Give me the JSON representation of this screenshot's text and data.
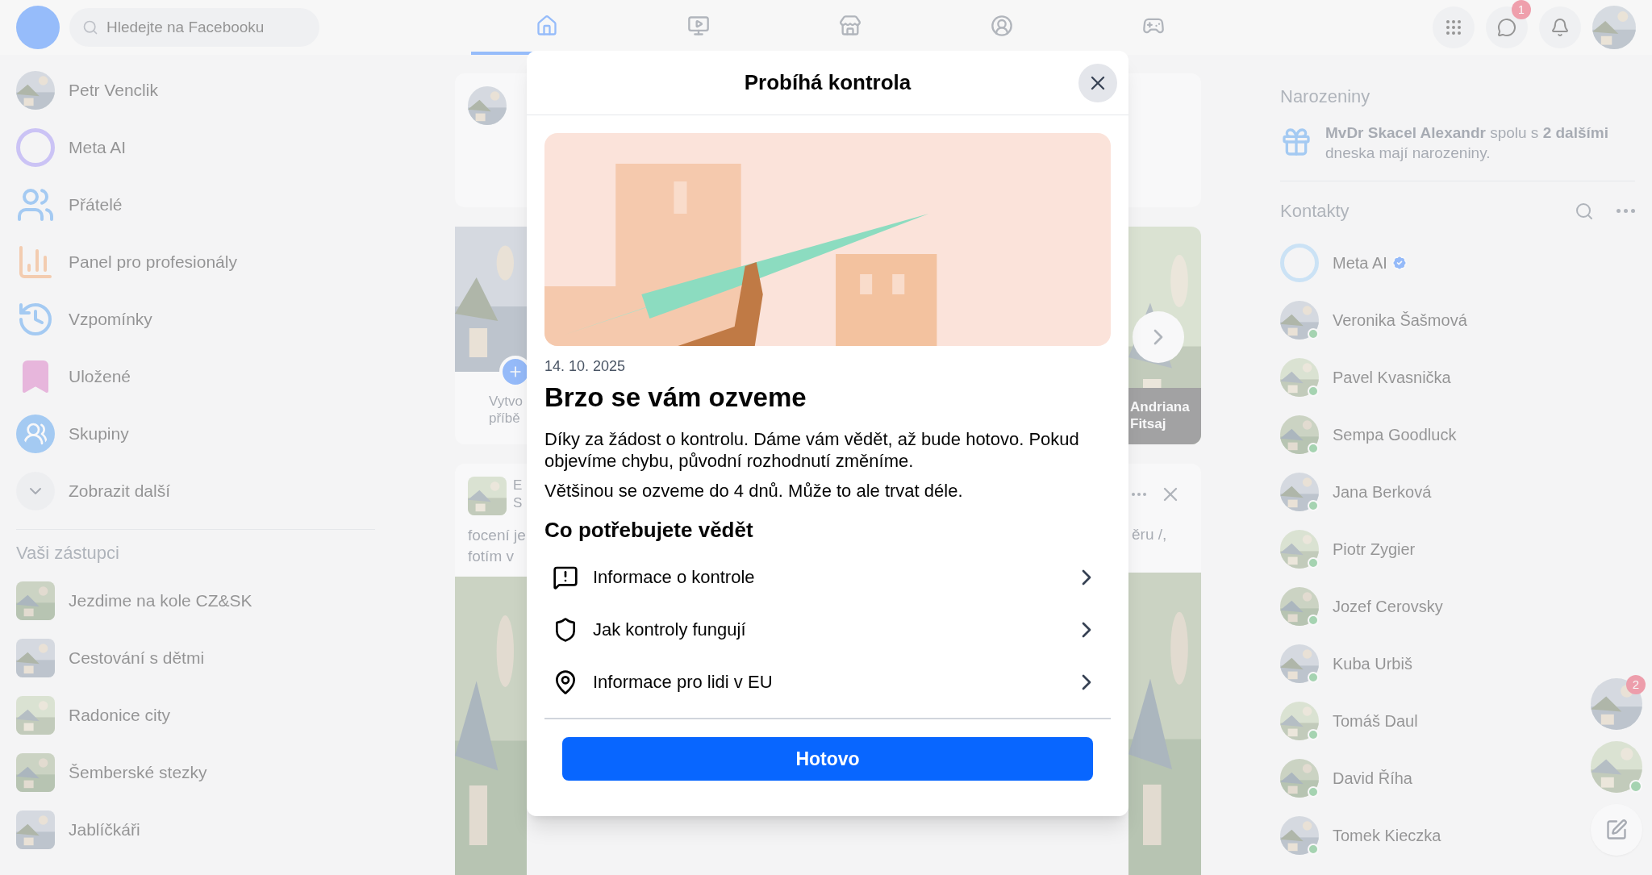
{
  "top_bar": {
    "search": {
      "placeholder": "Hledejte na Facebooku"
    },
    "nav": [
      {
        "kind": "home",
        "selected": true
      },
      {
        "kind": "video",
        "selected": false
      },
      {
        "kind": "market",
        "selected": false
      },
      {
        "kind": "profile",
        "selected": false
      },
      {
        "kind": "gaming",
        "selected": false
      }
    ],
    "messenger_badge": "1"
  },
  "left_sidebar": {
    "items": [
      {
        "kind": "avatar",
        "label": "Petr Venclik"
      },
      {
        "kind": "meta",
        "label": "Meta AI"
      },
      {
        "kind": "friends",
        "label": "Přátelé"
      },
      {
        "kind": "panel",
        "label": "Panel pro profesionály"
      },
      {
        "kind": "memories",
        "label": "Vzpomínky"
      },
      {
        "kind": "saved",
        "label": "Uložené"
      },
      {
        "kind": "groups",
        "label": "Skupiny"
      },
      {
        "kind": "more",
        "label": "Zobrazit další"
      }
    ],
    "shortcuts_title": "Vaši zástupci",
    "shortcuts": [
      {
        "label": "Jezdime na kole CZ&SK"
      },
      {
        "label": "Cestování s dětmi"
      },
      {
        "label": "Radonice city"
      },
      {
        "label": "Šemberské stezky"
      },
      {
        "label": "Jablíčkáři"
      }
    ]
  },
  "feed_left": {
    "story_caption": [
      "Vytvo",
      "příbě"
    ],
    "post_header": [
      "E",
      "S"
    ],
    "post_text": [
      "focení je",
      "fotím v"
    ]
  },
  "feed_right": {
    "story_caption": [
      "Andriana",
      "Fitsaj"
    ],
    "post_text": "ěru /,"
  },
  "dialog": {
    "title": "Probíhá kontrola",
    "date": "14. 10. 2025",
    "heading": "Brzo se vám ozveme",
    "paragraphs": [
      "Díky za žádost o kontrolu. Dáme vám vědět, až bude hotovo. Pokud objevíme chybu, původní rozhodnutí změníme.",
      "Většinou se ozveme do 4 dnů. Může to ale trvat déle."
    ],
    "section_title": "Co potřebujete vědět",
    "links": [
      {
        "kind": "alert",
        "label": "Informace o kontrole"
      },
      {
        "kind": "shield",
        "label": "Jak kontroly fungují"
      },
      {
        "kind": "pin",
        "label": "Informace pro lidi v EU"
      }
    ],
    "button": "Hotovo"
  },
  "right_sidebar": {
    "birthdays_title": "Narozeniny",
    "birthdays_text": "**MvDr Skacel Alexandr** spolu s **2 dalšími** dneska mají narozeniny.",
    "contacts_title": "Kontakty",
    "contacts": [
      {
        "name": "Meta AI",
        "online": false,
        "verified": true
      },
      {
        "name": "Veronika Šašmová",
        "online": true,
        "verified": false
      },
      {
        "name": "Pavel Kvasnička",
        "online": true,
        "verified": false
      },
      {
        "name": "Sempa Goodluck",
        "online": true,
        "verified": false
      },
      {
        "name": "Jana Berková",
        "online": true,
        "verified": false
      },
      {
        "name": "Piotr Zygier",
        "online": true,
        "verified": false
      },
      {
        "name": "Jozef Cerovsky",
        "online": true,
        "verified": false
      },
      {
        "name": "Kuba Urbiš",
        "online": true,
        "verified": false
      },
      {
        "name": "Tomáš Daul",
        "online": true,
        "verified": false
      },
      {
        "name": "David Říha",
        "online": true,
        "verified": false
      },
      {
        "name": "Tomek Kieczka",
        "online": true,
        "verified": false
      }
    ],
    "chat_heads": [
      {
        "badge": "2",
        "online": false
      },
      {
        "online": true
      }
    ]
  }
}
